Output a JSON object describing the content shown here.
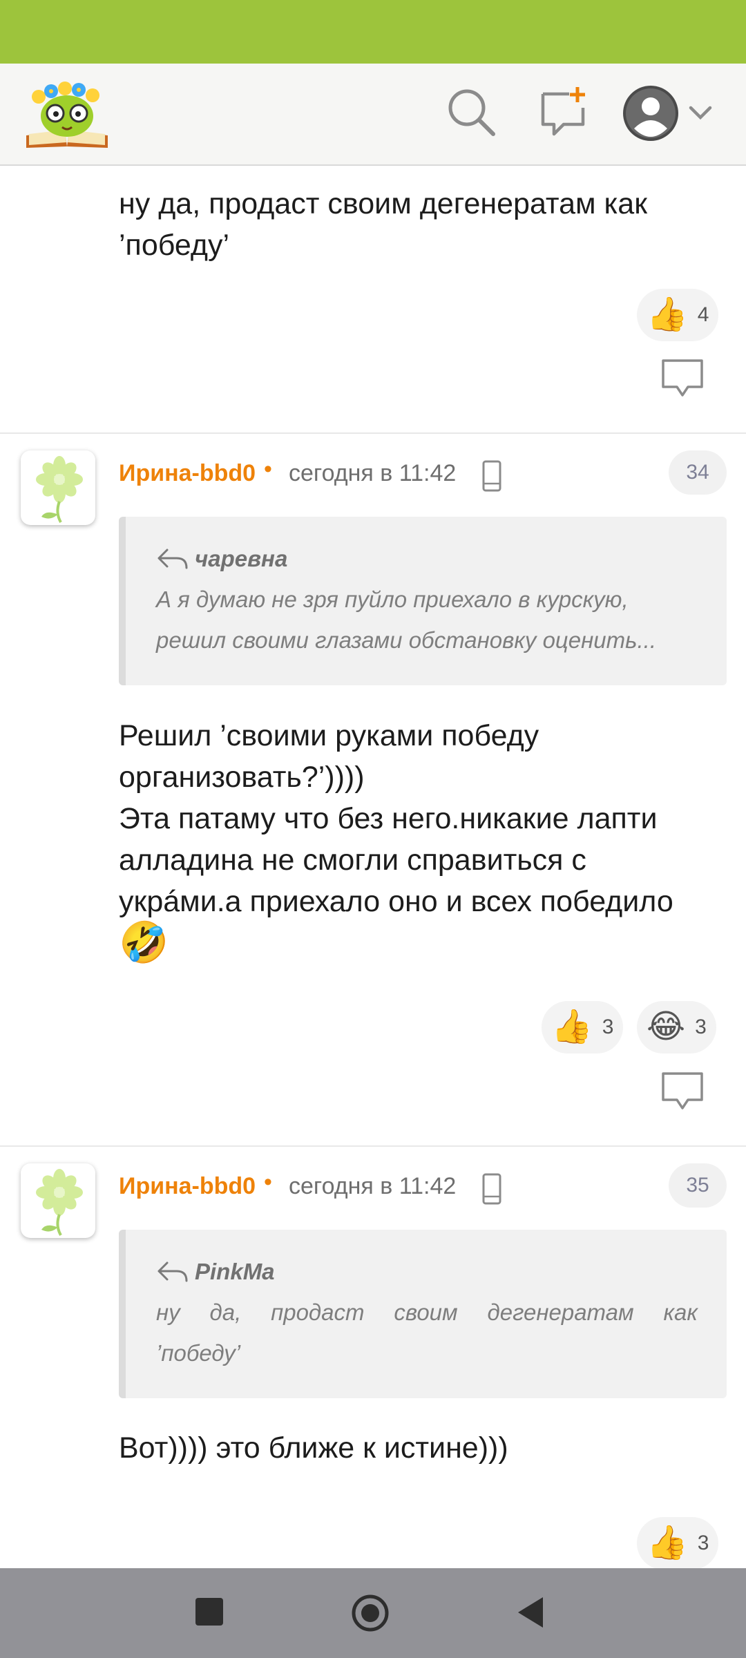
{
  "colors": {
    "status_bar": "#9dc43c",
    "accent_orange": "#ee8209",
    "header_bg": "#f6f6f4",
    "nav_bar": "#929297"
  },
  "header": {
    "logo": "odnoklassniki-book-logo",
    "icons": [
      "search-icon",
      "compose-message-icon",
      "user-avatar-icon",
      "chevron-down-icon"
    ]
  },
  "post_top": {
    "text_line1": "ну да, продаст своим дегенератам как",
    "text_line2": "’победу’",
    "reactions": [
      {
        "emoji": "👍",
        "count": "4"
      }
    ]
  },
  "comments": [
    {
      "author": "Ирина-bbd0",
      "separator": "•",
      "time": "сегодня в 11:42",
      "number": "34",
      "quote": {
        "author": "чаревна",
        "line1": "А я думаю не зря пуйло приехало в курскую,",
        "line2": "решил своими глазами обстановку оценить..."
      },
      "text_lines": [
        "Решил ’своими руками победу",
        "организовать?’))))",
        "Эта патаму что без него.никакие лапти",
        "алладина не смогли справиться с",
        "укрáми.а приехало оно и всех победило"
      ],
      "inline_emoji": "🤣",
      "reactions": [
        {
          "emoji": "👍",
          "count": "3"
        },
        {
          "emoji": "😂",
          "count": "3"
        }
      ]
    },
    {
      "author": "Ирина-bbd0",
      "separator": "•",
      "time": "сегодня в 11:42",
      "number": "35",
      "quote": {
        "author": "PinkMa",
        "line1": "ну да, продаст своим дегенератам как",
        "line2": "’победу’"
      },
      "text_lines": [
        "Вот)))) это ближе к истине)))"
      ],
      "reactions": [
        {
          "emoji": "👍",
          "count": "3"
        }
      ]
    }
  ],
  "nav": {
    "icons": [
      "recent-apps-icon",
      "home-icon",
      "back-icon"
    ]
  }
}
